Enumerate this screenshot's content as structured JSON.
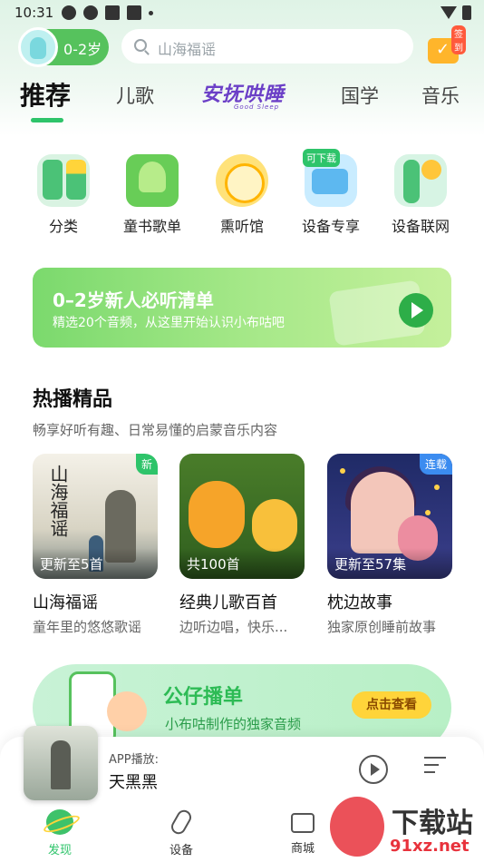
{
  "status_bar": {
    "time": "10:31"
  },
  "header": {
    "age_label": "0-2岁",
    "search_placeholder": "山海福谣",
    "checkin_label": "签到"
  },
  "tabs": [
    {
      "label": "推荐"
    },
    {
      "label": "儿歌"
    },
    {
      "label": "安抚哄睡",
      "sublabel": "Good Sleep"
    },
    {
      "label": "国学"
    },
    {
      "label": "音乐"
    }
  ],
  "quick_links": [
    {
      "label": "分类",
      "icon": "category-icon"
    },
    {
      "label": "童书歌单",
      "icon": "book-icon"
    },
    {
      "label": "熏听馆",
      "icon": "listening-hall-icon"
    },
    {
      "label": "设备专享",
      "icon": "device-icon",
      "tag": "可下载"
    },
    {
      "label": "设备联网",
      "icon": "network-icon"
    }
  ],
  "banner": {
    "title": "0–2岁新人必听清单",
    "subtitle": "精选20个音频，从这里开始认识小布咕吧"
  },
  "section": {
    "title": "热播精品",
    "subtitle": "畅享好听有趣、日常易懂的启蒙音乐内容"
  },
  "cards": [
    {
      "cover_text": "山海福谣",
      "badge": "新",
      "count": "更新至5首",
      "title": "山海福谣",
      "desc": "童年里的悠悠歌谣"
    },
    {
      "count": "共100首",
      "title": "经典儿歌百首",
      "desc": "边听边唱，快乐..."
    },
    {
      "badge": "连载",
      "count": "更新至57集",
      "title": "枕边故事",
      "desc": "独家原创睡前故事"
    }
  ],
  "banner2": {
    "title": "公仔播单",
    "subtitle": "小布咕制作的独家音频",
    "button": "点击查看"
  },
  "player": {
    "label": "APP播放:",
    "title": "天黑黑"
  },
  "nav": [
    {
      "label": "发现",
      "active": true
    },
    {
      "label": "设备",
      "active": false
    },
    {
      "label": "商城",
      "active": false
    }
  ],
  "watermark": {
    "text": "下载站",
    "url": "91xz.net"
  },
  "colors": {
    "accent": "#2ec46a",
    "brand_purple": "#6b3fc7"
  }
}
